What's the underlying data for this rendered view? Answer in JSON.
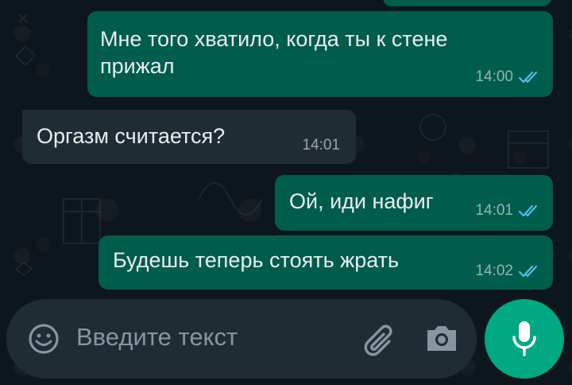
{
  "messages": [
    {
      "direction": "out",
      "text_line1": "Мне того хватило, когда ты к стене",
      "text_line2": "прижал",
      "time": "14:00",
      "status": "read"
    },
    {
      "direction": "in",
      "text": "Оргазм считается?",
      "time": "14:01"
    },
    {
      "direction": "out",
      "text": "Ой, иди нафиг",
      "time": "14:01",
      "status": "read"
    },
    {
      "direction": "out",
      "text": "Будешь теперь стоять жрать",
      "time": "14:02",
      "status": "read"
    }
  ],
  "composer": {
    "placeholder": "Введите текст"
  },
  "icons": {
    "emoji": "emoji-icon",
    "attach": "paperclip-icon",
    "camera": "camera-icon",
    "mic": "mic-icon",
    "read_ticks": "double-check-icon"
  },
  "colors": {
    "outgoing_bubble": "#005c4b",
    "incoming_bubble": "#202c33",
    "read_ticks": "#53bdeb",
    "mic_button": "#00a884",
    "background": "#0d161c"
  }
}
